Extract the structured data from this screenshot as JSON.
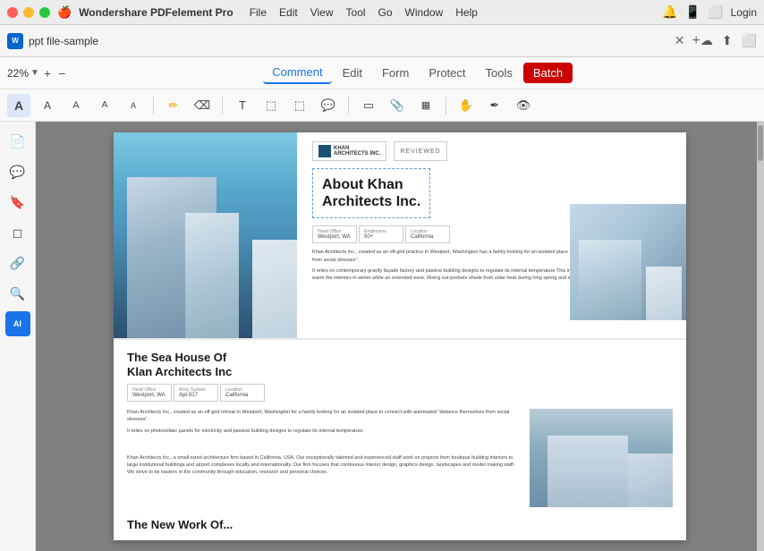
{
  "titleBar": {
    "appName": "Wondershare PDFelement Pro",
    "menus": [
      "File",
      "Edit",
      "View",
      "Tool",
      "Go",
      "Window",
      "Help"
    ],
    "loginLabel": "Login"
  },
  "tab": {
    "label": "ppt file-sample",
    "addTitle": "+"
  },
  "toolbar": {
    "zoomValue": "22%",
    "zoomIn": "+",
    "zoomOut": "−",
    "tabs": [
      "Comment",
      "Edit",
      "Form",
      "Protect",
      "Tools",
      "Batch"
    ]
  },
  "subToolbar": {
    "tools": [
      "A",
      "A",
      "A",
      "A",
      "A",
      "✏",
      "◻",
      "T",
      "⬚",
      "⬚",
      "💬",
      "▭",
      "📎",
      "▦",
      "✋",
      "✒",
      "👁"
    ]
  },
  "sidebarIcons": [
    "📄",
    "💬",
    "🔖",
    "◻",
    "🔗",
    "🔍",
    "AI"
  ],
  "page": {
    "topSection": {
      "headerLogos": [
        "KHAN ARCHITECTS INC.",
        "REVIEWED"
      ],
      "titleLine1": "About Khan",
      "titleLine2": "Architects Inc.",
      "infoTable": [
        {
          "label": "Head Office",
          "value": "Westport, WA"
        },
        {
          "label": "Employees",
          "value": "50+"
        },
        {
          "label": "Location",
          "value": "California"
        }
      ],
      "bodyText1": "Khan Architects Inc., created as an off-grid practice in Westport, Washington has a family looking for an isolated place to connect with nature and \"distance themselves from social stresses\".",
      "bodyText2": "It relies on contemporary gravity façade factory and passive building designs to regulate its internal temperature This includes sloped roofs that bring sunlight in to warm the interiors in winter while an extended eave. Rising out-pockets shade from solar heat during long spring and summer."
    },
    "bottomSection": {
      "title": "The Sea House Of\nKlan Architects Inc",
      "bodyText1": "Khan Architects Inc., created as an off-grid retreat in Westport, Washington for a family looking for an isolated place to connect with automated \"distance themselves from social stresses\".",
      "bodyText2": "It relies on photovoltaic panels for electricity and passive building designs to regulate its internal temperature."
    },
    "footerSection": {
      "title": "The New Work Of..."
    }
  }
}
